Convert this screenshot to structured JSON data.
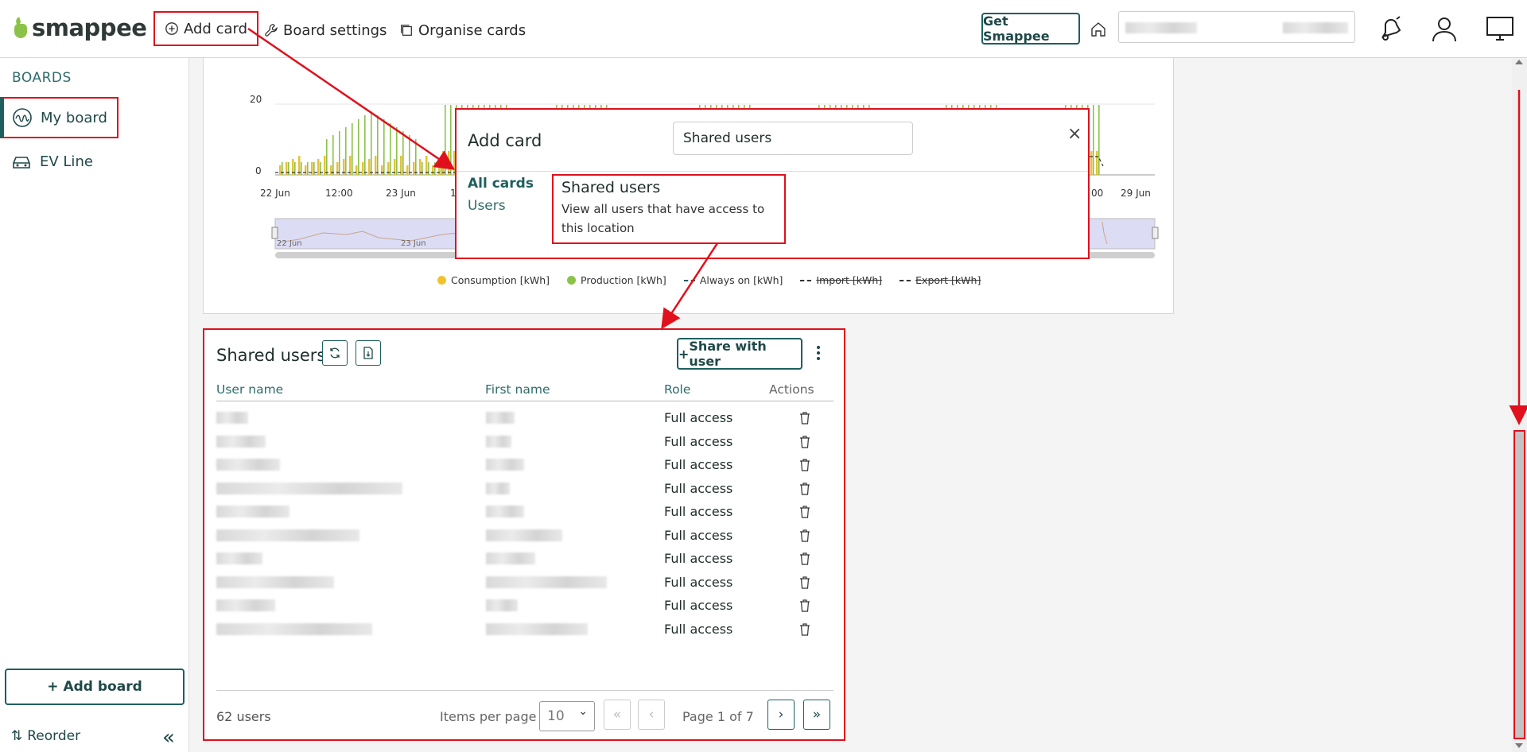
{
  "brand": {
    "name": "smappee",
    "accent": "#8bc34a",
    "primary": "#1f5f5f",
    "highlight": "#e0101d"
  },
  "toolbar": {
    "add_card": "Add card",
    "board_settings": "Board settings",
    "organise_cards": "Organise cards",
    "get_smappee": "Get Smappee"
  },
  "sidebar": {
    "heading": "BOARDS",
    "items": [
      {
        "label": "My board",
        "icon": "wave-icon",
        "active": true
      },
      {
        "label": "EV Line",
        "icon": "car-icon",
        "active": false
      }
    ],
    "add_board": "Add board",
    "reorder": "Reorder"
  },
  "chart": {
    "y_ticks": [
      "20",
      "0"
    ],
    "x_ticks": [
      "22 Jun",
      "12:00",
      "23 Jun",
      "1",
      "00",
      "29 Jun"
    ],
    "navigator_ticks": [
      "22 Jun",
      "23 Jun"
    ],
    "legend": [
      {
        "label": "Consumption [kWh]",
        "color": "#f2c12e",
        "style": "dot",
        "hidden": false
      },
      {
        "label": "Production [kWh]",
        "color": "#8bc34a",
        "style": "dot",
        "hidden": false
      },
      {
        "label": "Always on [kWh]",
        "color": "#1f5f5f",
        "style": "dash",
        "hidden": false
      },
      {
        "label": "Import [kWh]",
        "color": "#333333",
        "style": "dash",
        "hidden": true
      },
      {
        "label": "Export [kWh]",
        "color": "#333333",
        "style": "dash",
        "hidden": true
      }
    ]
  },
  "modal": {
    "title": "Add card",
    "search_value": "Shared users",
    "close": "×",
    "categories": [
      "All cards",
      "Users"
    ],
    "result": {
      "title": "Shared users",
      "description": "View all users that have access to this location"
    }
  },
  "shared_users": {
    "title": "Shared users",
    "share_button": "Share with user",
    "columns": [
      "User name",
      "First name",
      "Role",
      "Actions"
    ],
    "rows": [
      {
        "role": "Full access"
      },
      {
        "role": "Full access"
      },
      {
        "role": "Full access"
      },
      {
        "role": "Full access"
      },
      {
        "role": "Full access"
      },
      {
        "role": "Full access"
      },
      {
        "role": "Full access"
      },
      {
        "role": "Full access"
      },
      {
        "role": "Full access"
      },
      {
        "role": "Full access"
      }
    ],
    "count_label": "62 users",
    "items_per_page_label": "Items per page",
    "items_per_page": "10",
    "page_label": "Page 1 of 7",
    "pager": {
      "first": "«",
      "prev": "‹",
      "next": "›",
      "last": "»"
    }
  }
}
